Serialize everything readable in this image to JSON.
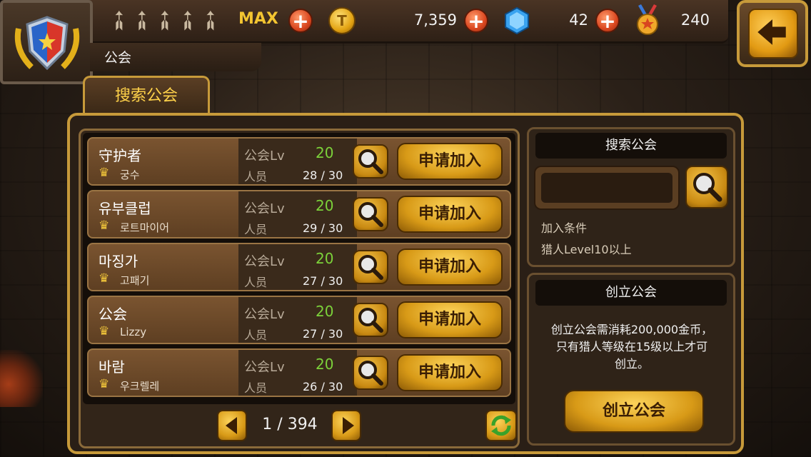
{
  "colors": {
    "accent_gold": "#c79a3a",
    "level_green": "#7cd23a",
    "currency_gold": "#f3c531"
  },
  "header": {
    "arrows_status": "MAX",
    "coins": "7,359",
    "gems": "42",
    "medals": "240",
    "section_title": "公会"
  },
  "tabs": [
    {
      "label": "搜索公会",
      "active": true
    }
  ],
  "guild_list": {
    "level_label": "公会Lv",
    "members_label": "人员",
    "join_label": "申请加入",
    "guilds": [
      {
        "name": "守护者",
        "leader": "궁수",
        "level": "20",
        "members": "28 / 30"
      },
      {
        "name": "유부클럽",
        "leader": "로트마이어",
        "level": "20",
        "members": "29 / 30"
      },
      {
        "name": "마징가",
        "leader": "고패기",
        "level": "20",
        "members": "27 / 30"
      },
      {
        "name": "公会",
        "leader": "Lizzy",
        "level": "20",
        "members": "27 / 30"
      },
      {
        "name": "바람",
        "leader": "우크렐레",
        "level": "20",
        "members": "26 / 30"
      }
    ]
  },
  "pagination": {
    "label": "1 / 394"
  },
  "search_panel": {
    "title": "搜索公会",
    "input_value": "",
    "condition_title": "加入条件",
    "condition_text": "猎人Level10以上"
  },
  "create_panel": {
    "title": "创立公会",
    "description": "创立公会需消耗200,000金币，\n只有猎人等级在15级以上才可\n创立。",
    "button_label": "创立公会"
  }
}
